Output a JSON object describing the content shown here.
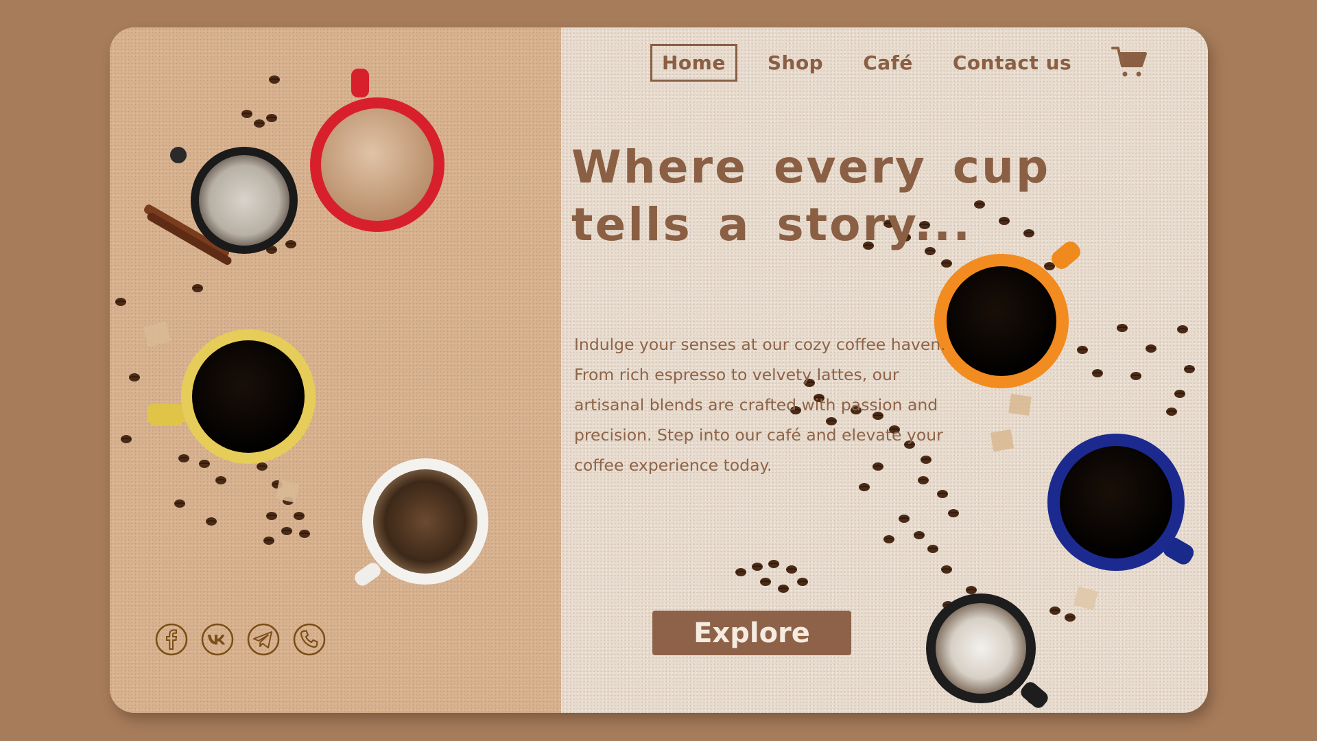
{
  "nav": {
    "items": [
      {
        "label": "Home",
        "active": true
      },
      {
        "label": "Shop",
        "active": false
      },
      {
        "label": "Café",
        "active": false
      },
      {
        "label": "Contact us",
        "active": false
      }
    ],
    "cart_icon": "shopping-cart-icon"
  },
  "hero": {
    "headline_line1": "Where every cup",
    "headline_line2": "tells a story...",
    "body": "Indulge your senses at our cozy coffee haven. From rich espresso to velvety lattes, our artisanal blends are crafted with passion and precision. Step into our café and elevate your coffee experience today.",
    "cta_label": "Explore"
  },
  "social": [
    {
      "icon": "facebook-icon"
    },
    {
      "icon": "vk-icon"
    },
    {
      "icon": "telegram-icon"
    },
    {
      "icon": "phone-icon"
    }
  ],
  "colors": {
    "page_bg": "#a67c5b",
    "left_panel": "#d8b28f",
    "right_panel": "#e8dccf",
    "text_brown": "#8a5f43",
    "button_bg": "#8e6248",
    "icon_outline": "#7a4e16"
  }
}
